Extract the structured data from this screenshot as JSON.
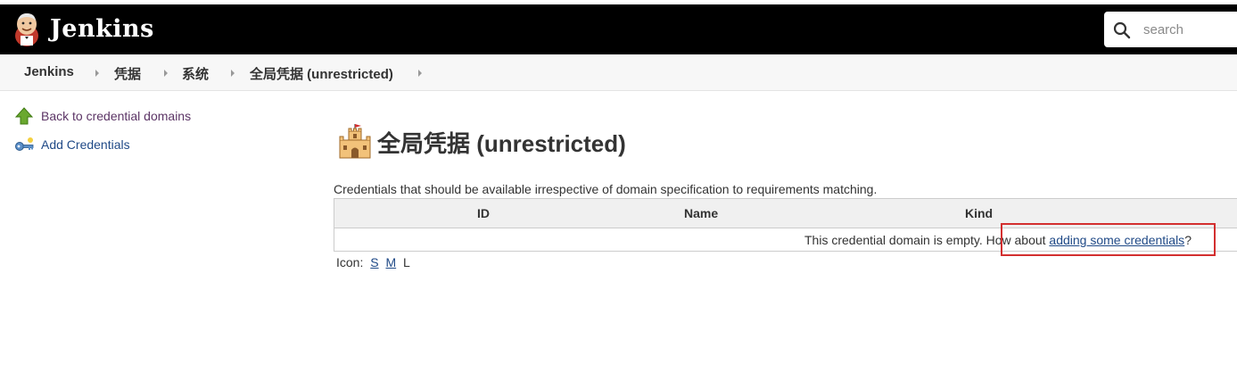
{
  "header": {
    "brand": "Jenkins",
    "search_placeholder": "search"
  },
  "breadcrumbs": [
    "Jenkins",
    "凭据",
    "系统",
    "全局凭据 (unrestricted)"
  ],
  "sidebar": {
    "items": [
      {
        "label": "Back to credential domains",
        "icon": "up-arrow-icon",
        "color": "#5c3566"
      },
      {
        "label": "Add Credentials",
        "icon": "key-icon",
        "color": "#204a87"
      }
    ]
  },
  "main": {
    "title": "全局凭据 (unrestricted)",
    "description": "Credentials that should be available irrespective of domain specification to requirements matching.",
    "table": {
      "columns": [
        "ID",
        "Name",
        "Kind"
      ],
      "empty_prefix": "This credential domain is empty. How about ",
      "empty_link": "adding some credentials",
      "empty_suffix": "?"
    },
    "icon_size": {
      "label": "Icon:",
      "options": [
        "S",
        "M",
        "L"
      ],
      "selected": "L"
    }
  },
  "colors": {
    "header_bg": "#000000",
    "link": "#204a87",
    "visited_link": "#5c3566",
    "highlight": "#d32f2f"
  }
}
